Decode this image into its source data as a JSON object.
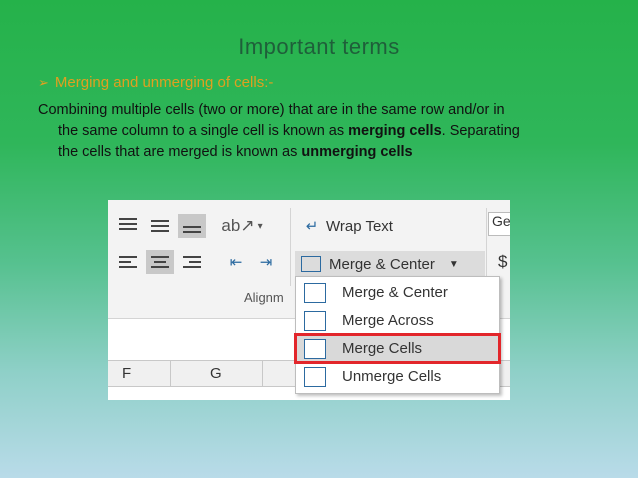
{
  "slide": {
    "title": "Important terms",
    "bullet": "Merging and unmerging of cells:-",
    "para_line1": "Combining multiple cells (two or more) that are in the same row and/or in",
    "para_line2_pre": "the same column to a single cell is known as ",
    "para_line2_bold": "merging cells",
    "para_line2_post": ". Separating",
    "para_line3_pre": "the cells that are merged is known as ",
    "para_line3_bold": "unmerging cells"
  },
  "ribbon": {
    "wrap_text": "Wrap Text",
    "merge_center": "Merge & Center",
    "group_label": "Alignm",
    "number_format": "Ge",
    "currency": "$"
  },
  "menu": {
    "items": [
      {
        "label": "Merge & Center"
      },
      {
        "label": "Merge Across"
      },
      {
        "label": "Merge Cells"
      },
      {
        "label": "Unmerge Cells"
      }
    ]
  },
  "columns": [
    "F",
    "G"
  ],
  "colors": {
    "highlight_border": "#e2262b",
    "bullet": "#e0a020"
  }
}
